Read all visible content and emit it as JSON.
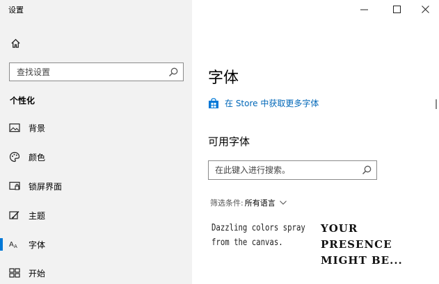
{
  "window": {
    "title": "设置",
    "controls": {
      "minimize": "—",
      "maximize": "☐",
      "close": "✕"
    }
  },
  "sidebar": {
    "home_icon": "home-icon",
    "search": {
      "placeholder": "查找设置",
      "icon": "search-icon"
    },
    "section_heading": "个性化",
    "items": [
      {
        "label": "背景",
        "icon": "picture-icon",
        "selected": false
      },
      {
        "label": "颜色",
        "icon": "palette-icon",
        "selected": false
      },
      {
        "label": "锁屏界面",
        "icon": "lock-screen-icon",
        "selected": false
      },
      {
        "label": "主题",
        "icon": "theme-brush-icon",
        "selected": false
      },
      {
        "label": "字体",
        "icon": "font-icon",
        "selected": true
      },
      {
        "label": "开始",
        "icon": "start-tiles-icon",
        "selected": false
      }
    ]
  },
  "main": {
    "title": "字体",
    "store_link": {
      "label": "在 Store 中获取更多字体",
      "icon": "store-bag-icon"
    },
    "available_heading": "可用字体",
    "font_search": {
      "placeholder": "在此键入进行搜索。",
      "icon": "search-icon"
    },
    "filter": {
      "label": "筛选条件:",
      "value": "所有语言"
    },
    "font_cards": [
      {
        "sample_lines": [
          "Dazzling colors spray",
          "from the canvas."
        ]
      },
      {
        "sample_lines": [
          "YOUR",
          "PRESENCE",
          "MIGHT BE..."
        ]
      }
    ]
  },
  "colors": {
    "accent": "#0078d7",
    "link": "#0067b8",
    "sidebar_bg": "#f2f2f2",
    "content_bg": "#ffffff"
  }
}
